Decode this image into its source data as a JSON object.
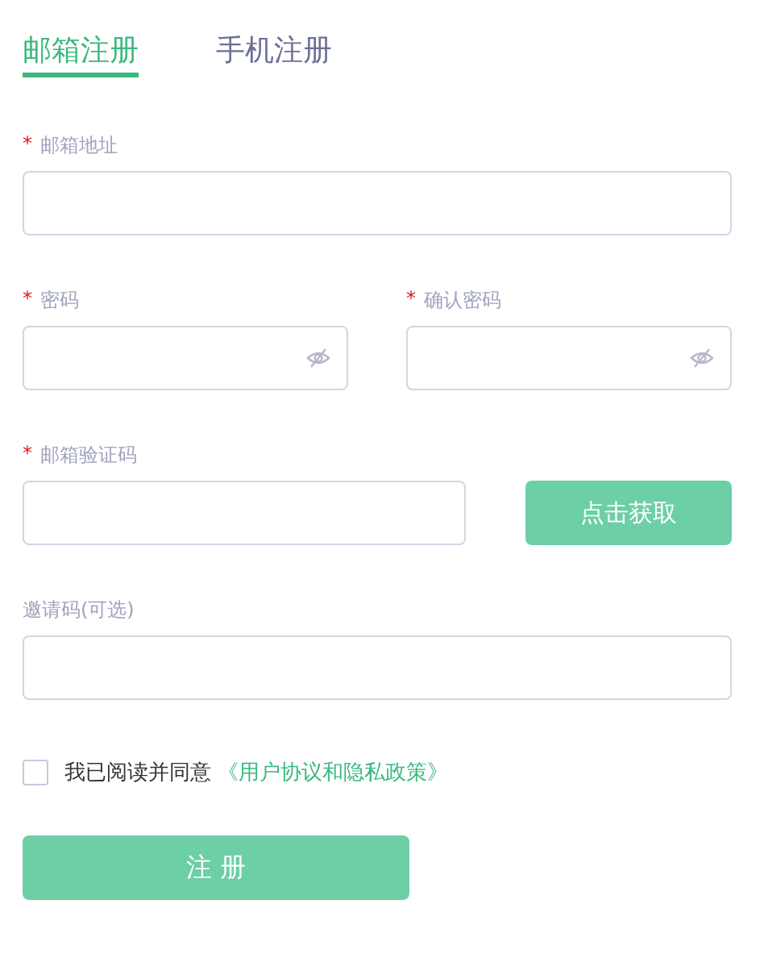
{
  "tabs": [
    {
      "label": "邮箱注册",
      "selected": true
    },
    {
      "label": "手机注册",
      "selected": false
    }
  ],
  "rows": [
    {
      "fields": [
        {
          "mark": "*",
          "label": "邮箱地址",
          "kind": "text"
        }
      ]
    },
    {
      "fields": [
        {
          "mark": "*",
          "label": "密码",
          "kind": "password"
        },
        {
          "mark": "*",
          "label": "确认密码",
          "kind": "password"
        }
      ]
    },
    {
      "fields": [
        {
          "mark": "*",
          "label": "邮箱验证码",
          "kind": "code",
          "button": "点击获取"
        }
      ]
    },
    {
      "fields": [
        {
          "label": "邀请码(可选)",
          "kind": "text"
        }
      ]
    }
  ],
  "agreement": {
    "checked": false,
    "text": "我已阅读并同意",
    "link": "《用户协议和隐私政策》"
  },
  "submit": "注 册"
}
